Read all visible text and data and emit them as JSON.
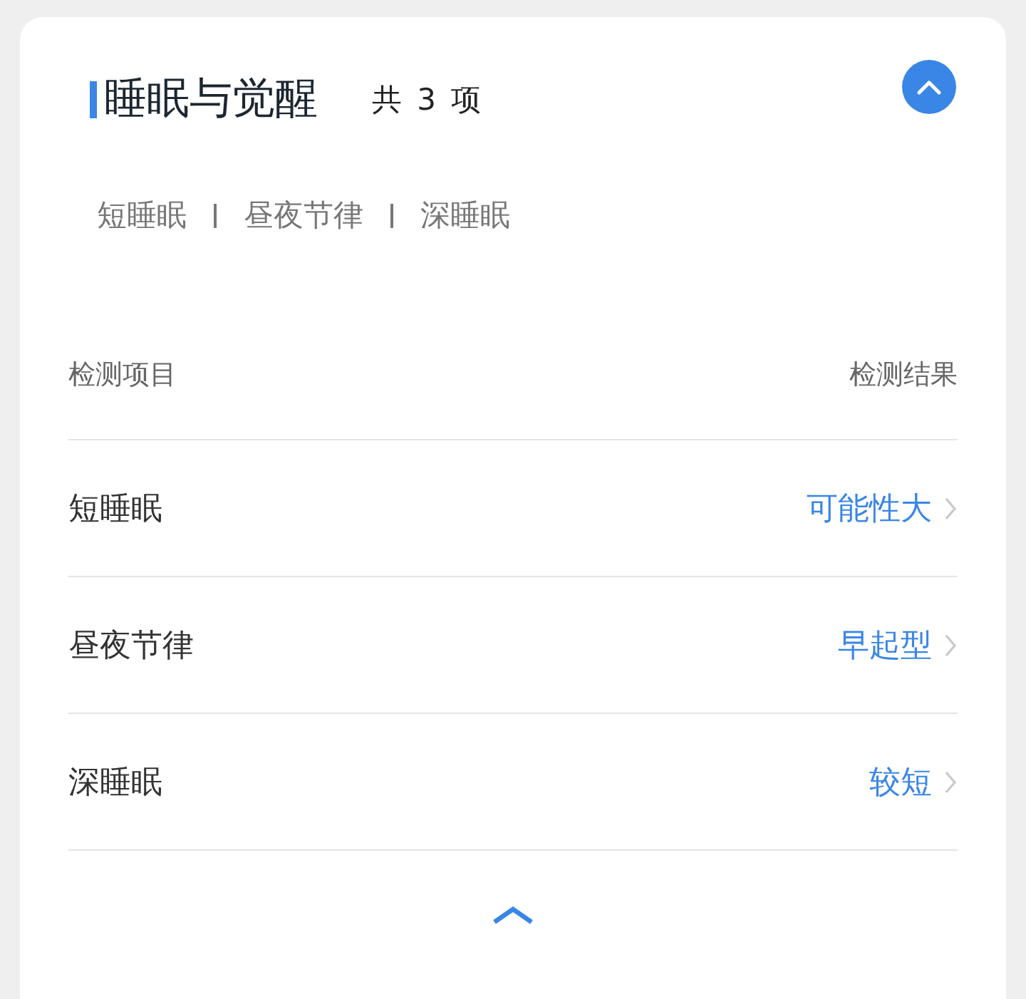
{
  "section": {
    "title": "睡眠与觉醒",
    "count": "共 3 项",
    "expanded": true
  },
  "tags": [
    "短睡眠",
    "昼夜节律",
    "深睡眠"
  ],
  "table": {
    "columns": [
      "检测项目",
      "检测结果"
    ],
    "rows": [
      {
        "item": "短睡眠",
        "result": "可能性大"
      },
      {
        "item": "昼夜节律",
        "result": "早起型"
      },
      {
        "item": "深睡眠",
        "result": "较短"
      }
    ]
  }
}
